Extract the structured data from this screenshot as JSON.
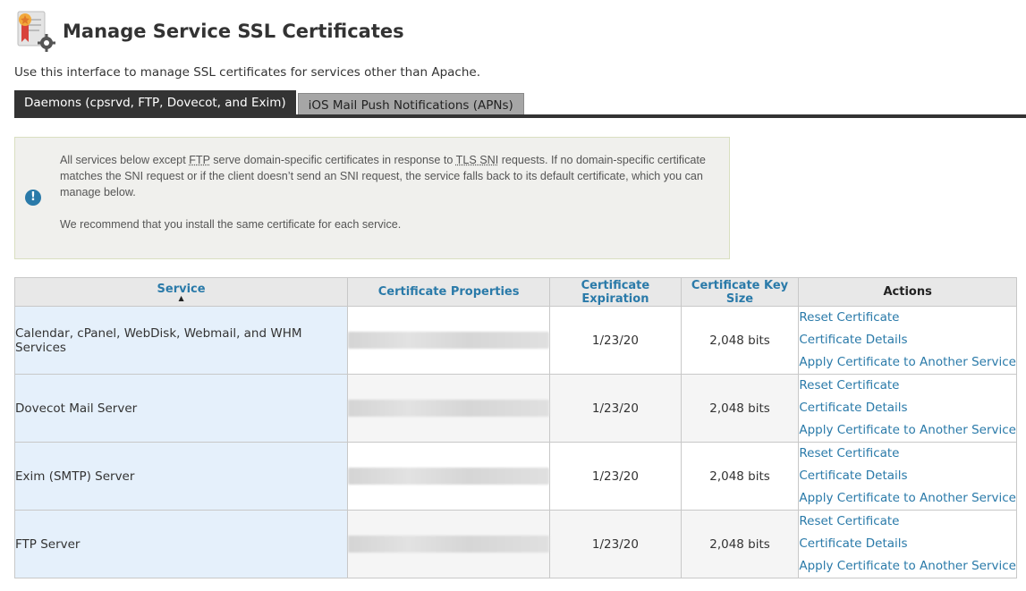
{
  "header": {
    "title": "Manage Service SSL Certificates",
    "icon": "certificate-settings-icon"
  },
  "intro": "Use this interface to manage SSL certificates for services other than Apache.",
  "tabs": [
    {
      "label": "Daemons (cpsrvd, FTP, Dovecot, and Exim)",
      "active": true
    },
    {
      "label": "iOS Mail Push Notifications (APNs)",
      "active": false
    }
  ],
  "notice": {
    "icon": "info-exclamation-icon",
    "p1_a": "All services below except ",
    "p1_ftp": "FTP",
    "p1_b": " serve domain-specific certificates in response to ",
    "p1_tls": "TLS SNI",
    "p1_c": " requests. If no domain-specific certificate matches the SNI request or if the client doesn’t send an SNI request, the service falls back to its default certificate, which you can manage below.",
    "p2": "We recommend that you install the same certificate for each service."
  },
  "table": {
    "headers": {
      "service": "Service",
      "properties": "Certificate Properties",
      "expiration": "Certificate Expiration",
      "key_size": "Certificate Key Size",
      "actions": "Actions"
    },
    "sort_indicator": "▲",
    "action_labels": {
      "reset": "Reset Certificate",
      "details": "Certificate Details",
      "apply": "Apply Certificate to Another Service"
    },
    "rows": [
      {
        "service": "Calendar, cPanel, WebDisk, Webmail, and WHM Services",
        "expiration": "1/23/20",
        "key_size": "2,048 bits"
      },
      {
        "service": "Dovecot Mail Server",
        "expiration": "1/23/20",
        "key_size": "2,048 bits"
      },
      {
        "service": "Exim (SMTP) Server",
        "expiration": "1/23/20",
        "key_size": "2,048 bits"
      },
      {
        "service": "FTP Server",
        "expiration": "1/23/20",
        "key_size": "2,048 bits"
      }
    ]
  },
  "colors": {
    "link": "#2a7aa9",
    "tab_active": "#333333",
    "service_cell": "#e5f0fb",
    "notice_bg": "#f0f0ed"
  }
}
